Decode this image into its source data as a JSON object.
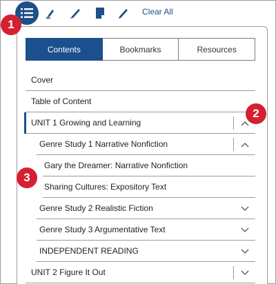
{
  "toolbar": {
    "clear_all_label": "Clear All",
    "icons": [
      "toc-menu-icon",
      "highlighter-icon",
      "pen-icon",
      "note-icon",
      "pencil-icon"
    ]
  },
  "markers": [
    "1",
    "2",
    "3"
  ],
  "tabs": [
    {
      "label": "Contents",
      "active": true
    },
    {
      "label": "Bookmarks",
      "active": false
    },
    {
      "label": "Resources",
      "active": false
    }
  ],
  "toc": {
    "cover": "Cover",
    "table_of_content": "Table of Content",
    "unit1": {
      "label": "UNIT 1 Growing and Learning",
      "expanded": true
    },
    "genre_study_1": {
      "label": "Genre Study 1 Narrative Nonfiction",
      "expanded": true
    },
    "gary": "Gary the Dreamer: Narrative Nonfiction",
    "sharing": "Sharing Cultures: Expository Text",
    "genre_study_2": {
      "label": "Genre Study 2 Realistic Fiction",
      "expanded": false
    },
    "genre_study_3": {
      "label": "Genre Study 3 Argumentative Text",
      "expanded": false
    },
    "independent_reading": {
      "label": "INDEPENDENT READING",
      "expanded": false
    },
    "unit2": {
      "label": "UNIT 2 Figure It Out",
      "expanded": false
    }
  },
  "colors": {
    "accent": "#1b4f8e",
    "marker": "#d42030",
    "border": "#9a9a9a"
  }
}
